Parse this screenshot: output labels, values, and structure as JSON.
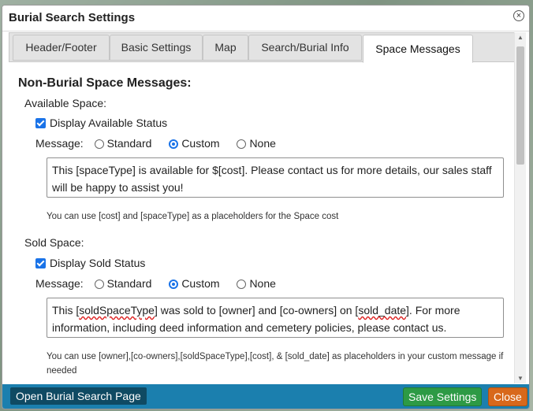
{
  "dialog": {
    "title": "Burial Search Settings"
  },
  "tabs": [
    {
      "label": "Header/Footer"
    },
    {
      "label": "Basic Settings"
    },
    {
      "label": "Map"
    },
    {
      "label": "Search/Burial Info"
    },
    {
      "label": "Space Messages",
      "active": true
    }
  ],
  "content": {
    "heading": "Non-Burial Space Messages:",
    "available": {
      "title": "Available Space:",
      "checkbox_label": "Display Available Status",
      "message_label": "Message:",
      "options": [
        "Standard",
        "Custom",
        "None"
      ],
      "selected": "Custom",
      "message_text": "This [spaceType] is available for $[cost]. Please contact us for more details, our sales staff will be happy to assist you!",
      "hint": "You can use [cost] and [spaceType] as a placeholders for the Space cost"
    },
    "sold": {
      "title": "Sold Space:",
      "checkbox_label": "Display Sold Status",
      "message_label": "Message:",
      "options": [
        "Standard",
        "Custom",
        "None"
      ],
      "selected": "Custom",
      "message_pre": "This [",
      "message_word1": "soldSpaceType",
      "message_mid": "] was sold to [owner] and [co-owners] on [",
      "message_word2": "sold_date",
      "message_post": "]. For more information, including deed information and cemetery policies, please contact us.",
      "hint": "You can use [owner],[co-owners],[soldSpaceType],[cost], & [sold_date] as placeholders in your custom message if needed"
    }
  },
  "footer": {
    "open_label": "Open Burial Search Page",
    "save_label": "Save Settings",
    "close_label": "Close"
  },
  "colors": {
    "accent": "#1a73e8",
    "footer_bg": "#1b7fae",
    "save_bg": "#2d9a45",
    "close_bg": "#d8681b",
    "open_bg": "#0f4a63"
  }
}
